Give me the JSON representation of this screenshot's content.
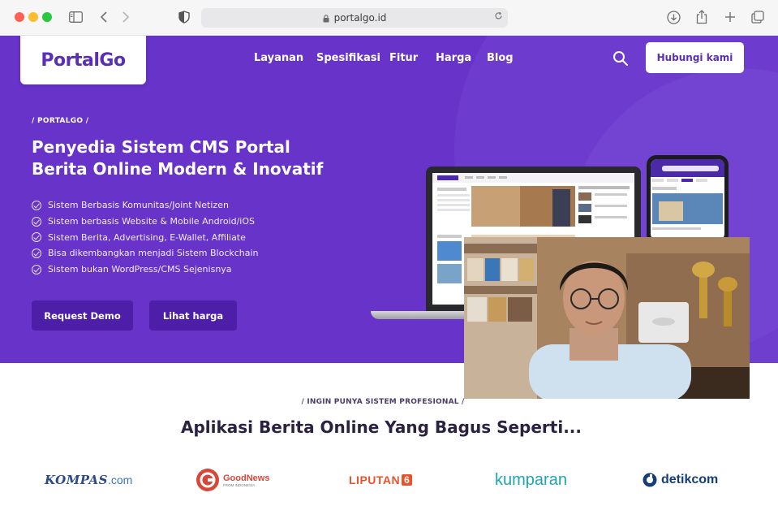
{
  "browser": {
    "url": "portalgo.id"
  },
  "header": {
    "logo_text": "PortalGo",
    "nav": [
      "Layanan",
      "Spesifikasi",
      "Fitur",
      "Harga",
      "Blog"
    ],
    "contact_label": "Hubungi kami"
  },
  "hero": {
    "breadcrumb": "/   PORTALGO   /",
    "title": "Penyedia Sistem CMS Portal Berita Online Modern & Inovatif",
    "features": [
      "Sistem Berbasis Komunitas/Joint Netizen",
      "Sistem berbasis Website & Mobile Android/iOS",
      "Sistem Berita, Advertising, E-Wallet, Affiliate",
      "Bisa dikembangkan menjadi Sistem Blockchain",
      "Sistem bukan WordPress/CMS Sejenisnya"
    ],
    "primary_button": "Request Demo",
    "secondary_button": "Lihat harga"
  },
  "section": {
    "breadcrumb": "/   INGIN PUNYA SISTEM PROFESIONAL   /",
    "title": "Aplikasi Berita Online Yang Bagus Seperti..."
  },
  "partners": {
    "kompas": "KOMPAS",
    "kompas_suffix": ".com",
    "goodnews": "GoodNews",
    "goodnews_sub": "FROM INDONESIA",
    "liputan": "LIPUTAN",
    "liputan_num": "6",
    "kumparan": "kumparan",
    "detik": "detikcom"
  },
  "colors": {
    "brand_purple": "#6733c9",
    "button_dark": "#4d1fa8"
  }
}
